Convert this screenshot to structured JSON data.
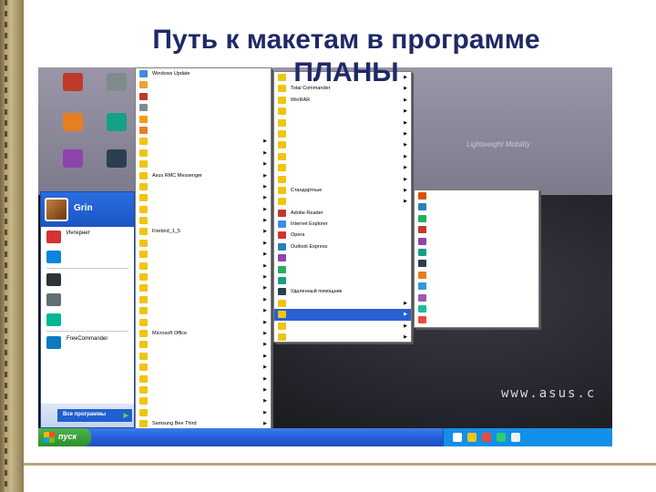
{
  "slide": {
    "title": "Путь к макетам в программе ПЛАНЫ"
  },
  "desktop": {
    "brand_text": "Lightweight Mobility",
    "asus_text": "www.asus.c",
    "icons": [
      {
        "label": "",
        "color": "#c0392b"
      },
      {
        "label": "",
        "color": "#7f8c8d"
      },
      {
        "label": "",
        "color": "#2e86de"
      },
      {
        "label": "",
        "color": "#d35400"
      },
      {
        "label": "",
        "color": "#e67e22"
      },
      {
        "label": "",
        "color": "#16a085"
      },
      {
        "label": "",
        "color": "#8e44ad"
      },
      {
        "label": "",
        "color": "#2c3e50"
      }
    ]
  },
  "start_menu": {
    "user": "Grin",
    "pinned": [
      {
        "label": "Интернет",
        "color": "#d63031"
      },
      {
        "label": "",
        "color": "#0984e3"
      },
      {
        "label": "",
        "color": "#2d3436"
      },
      {
        "label": "",
        "color": "#636e72"
      },
      {
        "label": "",
        "color": "#00b894"
      },
      {
        "label": "FreeCommander",
        "color": "#0a7ac4"
      }
    ],
    "all_programs": "Все программы"
  },
  "taskbar": {
    "start_label": "пуск",
    "tray_colors": [
      "#ffffff",
      "#f1c40f",
      "#e74c3c",
      "#2ecc71",
      "#ecf0f1"
    ]
  },
  "menus": {
    "menu1": [
      {
        "label": "Windows Update",
        "color": "#3d8ee0",
        "sub": false
      },
      {
        "label": "",
        "color": "#f0a030",
        "sub": false
      },
      {
        "label": "",
        "color": "#c0392b",
        "sub": false
      },
      {
        "label": "",
        "color": "#7f8c8d",
        "sub": false
      },
      {
        "label": "",
        "color": "#f39c12",
        "sub": false
      },
      {
        "label": "",
        "color": "#e67e22",
        "sub": false
      },
      {
        "label": "",
        "color": "#f1c40f",
        "sub": true
      },
      {
        "label": "",
        "color": "#f1c40f",
        "sub": true
      },
      {
        "label": "",
        "color": "#f1c40f",
        "sub": true
      },
      {
        "label": "Asus RMC Messenger",
        "color": "#f1c40f",
        "sub": true
      },
      {
        "label": "",
        "color": "#f1c40f",
        "sub": true
      },
      {
        "label": "",
        "color": "#f1c40f",
        "sub": true
      },
      {
        "label": "",
        "color": "#f1c40f",
        "sub": true
      },
      {
        "label": "",
        "color": "#f1c40f",
        "sub": true
      },
      {
        "label": "Firebird_1_5",
        "color": "#f1c40f",
        "sub": true
      },
      {
        "label": "",
        "color": "#f1c40f",
        "sub": true
      },
      {
        "label": "",
        "color": "#f1c40f",
        "sub": true
      },
      {
        "label": "",
        "color": "#f1c40f",
        "sub": true
      },
      {
        "label": "",
        "color": "#f1c40f",
        "sub": true
      },
      {
        "label": "",
        "color": "#f1c40f",
        "sub": true
      },
      {
        "label": "",
        "color": "#f1c40f",
        "sub": true
      },
      {
        "label": "",
        "color": "#f1c40f",
        "sub": true
      },
      {
        "label": "",
        "color": "#f1c40f",
        "sub": true
      },
      {
        "label": "Microsoft Office",
        "color": "#f1c40f",
        "sub": true
      },
      {
        "label": "",
        "color": "#f1c40f",
        "sub": true
      },
      {
        "label": "",
        "color": "#f1c40f",
        "sub": true
      },
      {
        "label": "",
        "color": "#f1c40f",
        "sub": true
      },
      {
        "label": "",
        "color": "#f1c40f",
        "sub": true
      },
      {
        "label": "",
        "color": "#f1c40f",
        "sub": true
      },
      {
        "label": "",
        "color": "#f1c40f",
        "sub": true
      },
      {
        "label": "",
        "color": "#f1c40f",
        "sub": true
      },
      {
        "label": "Samsung Bee Third",
        "color": "#f1c40f",
        "sub": true
      }
    ],
    "menu2": [
      {
        "label": "",
        "color": "#f1c40f",
        "sub": true
      },
      {
        "label": "Total Commander",
        "color": "#f1c40f",
        "sub": true
      },
      {
        "label": "WinRAR",
        "color": "#f1c40f",
        "sub": true
      },
      {
        "label": "",
        "color": "#f1c40f",
        "sub": true
      },
      {
        "label": "",
        "color": "#f1c40f",
        "sub": true
      },
      {
        "label": "",
        "color": "#f1c40f",
        "sub": true
      },
      {
        "label": "",
        "color": "#f1c40f",
        "sub": true
      },
      {
        "label": "",
        "color": "#f1c40f",
        "sub": true
      },
      {
        "label": "",
        "color": "#f1c40f",
        "sub": true
      },
      {
        "label": "",
        "color": "#f1c40f",
        "sub": true
      },
      {
        "label": "Стандартные",
        "color": "#f1c40f",
        "sub": true
      },
      {
        "label": "",
        "color": "#f1c40f",
        "sub": true
      },
      {
        "label": "Adobe Reader",
        "color": "#c0392b",
        "sub": false
      },
      {
        "label": "Internet Explorer",
        "color": "#3d8ee0",
        "sub": false
      },
      {
        "label": "Opera",
        "color": "#d63031",
        "sub": false
      },
      {
        "label": "Outlook Express",
        "color": "#2980b9",
        "sub": false
      },
      {
        "label": "",
        "color": "#8e44ad",
        "sub": false
      },
      {
        "label": "",
        "color": "#27ae60",
        "sub": false
      },
      {
        "label": "",
        "color": "#16a085",
        "sub": false
      },
      {
        "label": "Удаленный помощник",
        "color": "#2c3e50",
        "sub": false
      },
      {
        "label": "",
        "color": "#f1c40f",
        "sub": true
      },
      {
        "label": "",
        "color": "#f1c40f",
        "sub": true,
        "hl": true
      },
      {
        "label": "",
        "color": "#f1c40f",
        "sub": true
      },
      {
        "label": "",
        "color": "#f1c40f",
        "sub": true
      }
    ],
    "menu3": [
      {
        "label": "",
        "color": "#d35400"
      },
      {
        "label": "",
        "color": "#2980b9"
      },
      {
        "label": "",
        "color": "#27ae60"
      },
      {
        "label": "",
        "color": "#c0392b"
      },
      {
        "label": "",
        "color": "#8e44ad"
      },
      {
        "label": "",
        "color": "#16a085"
      },
      {
        "label": "",
        "color": "#2c3e50"
      },
      {
        "label": "",
        "color": "#e67e22"
      },
      {
        "label": "",
        "color": "#3498db"
      },
      {
        "label": "",
        "color": "#9b59b6"
      },
      {
        "label": "",
        "color": "#1abc9c"
      },
      {
        "label": "",
        "color": "#e74c3c"
      }
    ]
  }
}
